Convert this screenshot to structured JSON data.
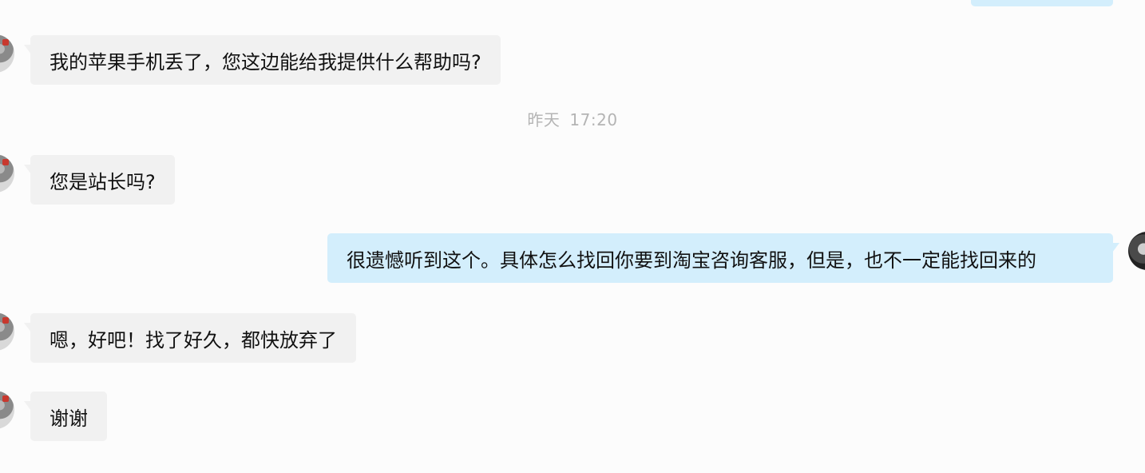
{
  "chat": {
    "messages": [
      {
        "sender": "other",
        "text": "我的苹果手机丢了，您这边能给我提供什么帮助吗?"
      },
      {
        "sender": "other",
        "text": "您是站长吗?"
      },
      {
        "sender": "self",
        "text": "很遗憾听到这个。具体怎么找回你要到淘宝咨询客服，但是，也不一定能找回来的"
      },
      {
        "sender": "other",
        "text": "嗯，好吧！找了好久，都快放弃了"
      },
      {
        "sender": "other",
        "text": "谢谢"
      }
    ],
    "timestamp": {
      "day": "昨天",
      "time": "17:20"
    }
  },
  "colors": {
    "incoming_bubble": "#f1f1f1",
    "outgoing_bubble": "#d3eefc",
    "timestamp_text": "#b4b4b4",
    "background": "#fcfcfc"
  },
  "icons": {
    "incoming_avatar": "user-avatar-icon",
    "outgoing_avatar": "self-avatar-icon"
  }
}
